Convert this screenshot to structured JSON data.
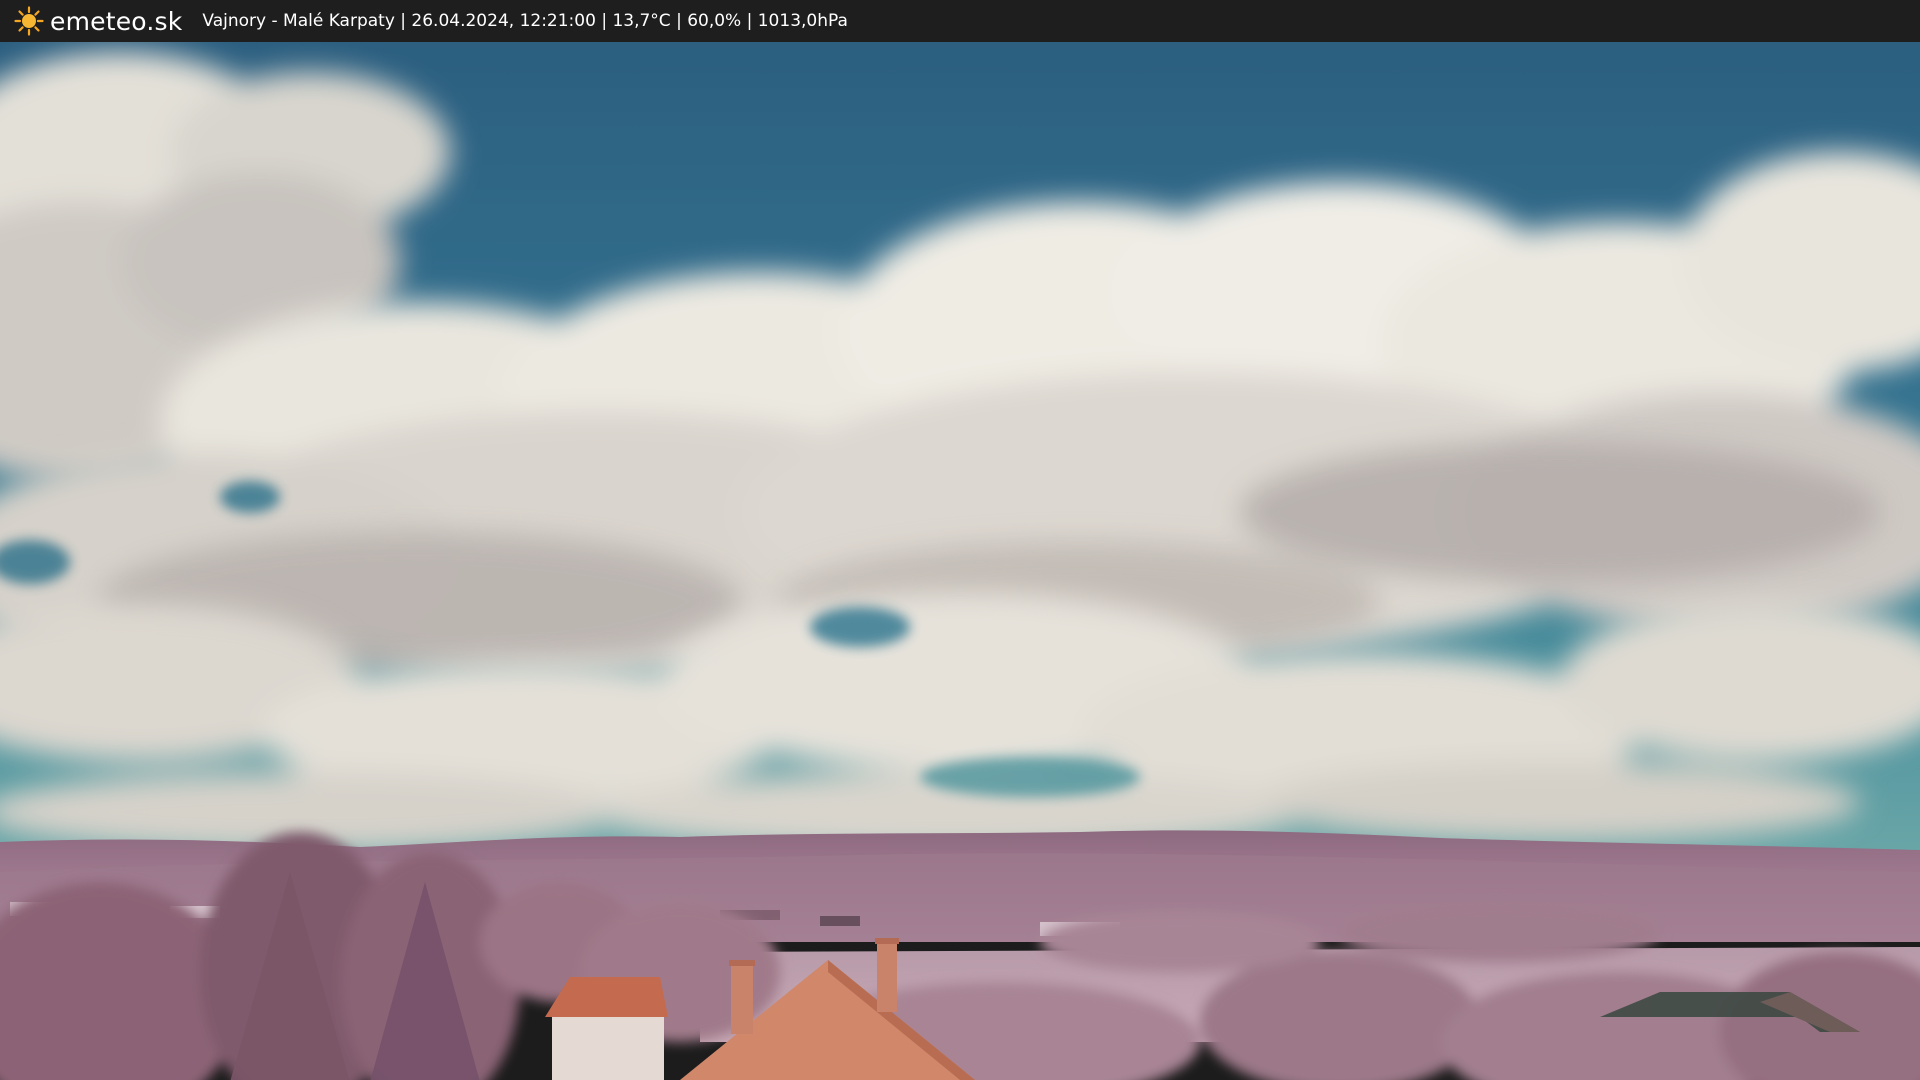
{
  "header": {
    "brand": "emeteo.sk",
    "logo_icon": "sun-icon",
    "caption": "Vajnory - Malé Karpaty | 26.04.2024, 12:21:00 | 13,7°C | 60,0% | 1013,0hPa"
  },
  "colors": {
    "bar_background": "#1e1e1e",
    "sun": "#f5a623",
    "sky": "#2f6c8c",
    "hills": "#a0788f",
    "roof": "#c9744f"
  }
}
